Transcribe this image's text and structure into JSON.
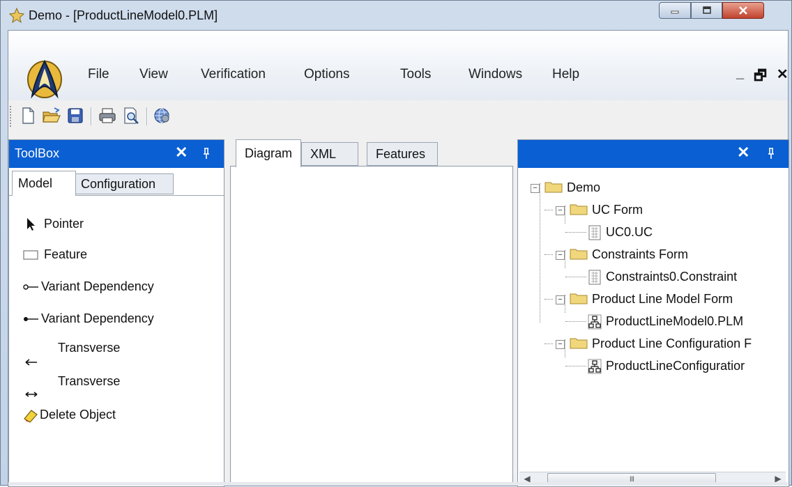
{
  "window": {
    "title": "Demo - [ProductLineModel0.PLM]"
  },
  "menu": {
    "items": [
      {
        "label": "File"
      },
      {
        "label": "View"
      },
      {
        "label": "Verification"
      },
      {
        "label": "Options"
      },
      {
        "label": "Tools"
      },
      {
        "label": "Windows"
      },
      {
        "label": "Help"
      }
    ],
    "mdi_controls": {
      "minimize": "_",
      "restore": "🗗",
      "close": "✕"
    }
  },
  "toolbar": {
    "buttons": [
      "new-icon",
      "open-icon",
      "save-icon",
      "print-icon",
      "print-preview-icon",
      "globe-icon"
    ]
  },
  "toolbox": {
    "title": "ToolBox",
    "close": "✕",
    "pin": "ᵖ",
    "tabs": [
      {
        "label": "Model"
      },
      {
        "label": "Configuration"
      }
    ],
    "items": [
      {
        "label": "Pointer"
      },
      {
        "label": "Feature"
      },
      {
        "label": "Variant Dependency"
      },
      {
        "label": "Variant Dependency"
      },
      {
        "label": "Transverse"
      },
      {
        "label": "Transverse"
      },
      {
        "label": "Delete Object"
      }
    ]
  },
  "center": {
    "tabs": [
      {
        "label": "Diagram"
      },
      {
        "label": "XML"
      },
      {
        "label": "Features"
      }
    ]
  },
  "explorer": {
    "close": "✕",
    "pin": "ᵖ",
    "tree": [
      {
        "label": "Demo"
      },
      {
        "label": "UC Form"
      },
      {
        "label": "UC0.UC"
      },
      {
        "label": "Constraints Form"
      },
      {
        "label": "Constraints0.Constraint"
      },
      {
        "label": "Product Line Model Form"
      },
      {
        "label": "ProductLineModel0.PLM"
      },
      {
        "label": "Product Line Configuration F"
      },
      {
        "label": "ProductLineConfiguratior"
      }
    ],
    "scroll_thumb": "III"
  },
  "colors": {
    "panel_header": "#0a5fd3",
    "window_frame": "#c2d3e7"
  }
}
